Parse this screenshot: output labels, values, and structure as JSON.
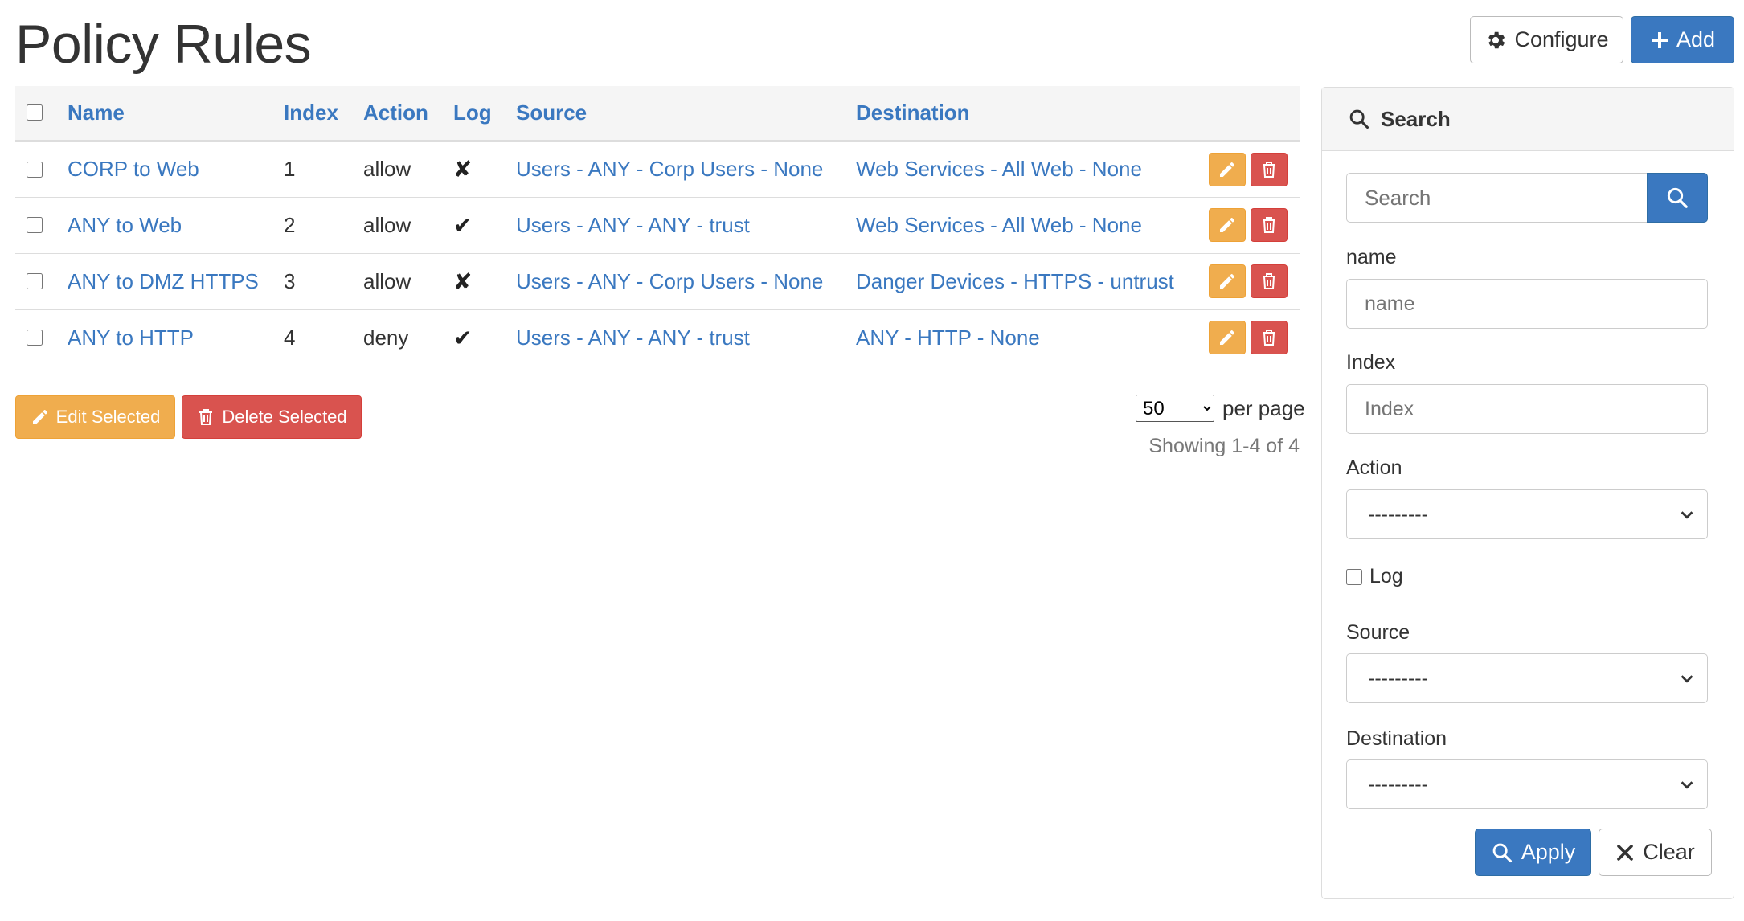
{
  "page": {
    "title": "Policy Rules"
  },
  "toolbar": {
    "configure_label": "Configure",
    "add_label": "Add"
  },
  "table": {
    "headers": [
      "Name",
      "Index",
      "Action",
      "Log",
      "Source",
      "Destination"
    ],
    "rows": [
      {
        "name": "CORP to Web",
        "index": "1",
        "action": "allow",
        "log": "✘",
        "source": "Users - ANY - Corp Users - None",
        "destination": "Web Services - All Web - None"
      },
      {
        "name": "ANY to Web",
        "index": "2",
        "action": "allow",
        "log": "✔",
        "source": "Users - ANY - ANY - trust",
        "destination": "Web Services - All Web - None"
      },
      {
        "name": "ANY to DMZ HTTPS",
        "index": "3",
        "action": "allow",
        "log": "✘",
        "source": "Users - ANY - Corp Users - None",
        "destination": "Danger Devices - HTTPS - untrust"
      },
      {
        "name": "ANY to HTTP",
        "index": "4",
        "action": "deny",
        "log": "✔",
        "source": "Users - ANY - ANY - trust",
        "destination": "ANY - HTTP - None"
      }
    ]
  },
  "bulk": {
    "edit_label": "Edit Selected",
    "delete_label": "Delete Selected"
  },
  "pagination": {
    "per_page_value": "50",
    "per_page_label": "per page",
    "showing": "Showing 1-4 of 4"
  },
  "search_panel": {
    "title": "Search",
    "search_placeholder": "Search",
    "fields": {
      "name_label": "name",
      "name_placeholder": "name",
      "index_label": "Index",
      "index_placeholder": "Index",
      "action_label": "Action",
      "action_value": "---------",
      "log_label": "Log",
      "source_label": "Source",
      "source_value": "---------",
      "destination_label": "Destination",
      "destination_value": "---------"
    },
    "apply_label": "Apply",
    "clear_label": "Clear"
  },
  "colors": {
    "primary": "#3a78c0",
    "warning": "#f0ad4e",
    "danger": "#d9534f",
    "header_bg": "#f5f5f5"
  }
}
